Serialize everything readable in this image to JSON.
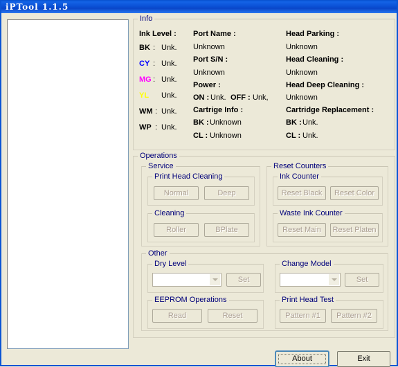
{
  "window": {
    "title": "iPTool 1.1.5"
  },
  "info": {
    "caption": "Info",
    "ink_level_label": "Ink Level :",
    "inks": [
      {
        "name": "BK",
        "sep": ":",
        "value": "Unk.",
        "color": "#000000"
      },
      {
        "name": "CY",
        "sep": ":",
        "value": "Unk.",
        "color": "#0000ff"
      },
      {
        "name": "MG",
        "sep": ":",
        "value": "Unk.",
        "color": "#ff00ff"
      },
      {
        "name": "YL",
        "sep": "",
        "value": "Unk.",
        "color": "#ffff00"
      },
      {
        "name": "WM",
        "sep": ":",
        "value": "Unk.",
        "color": "#000000"
      },
      {
        "name": "WP",
        "sep": ":",
        "value": "Unk.",
        "color": "#000000"
      }
    ],
    "port_name_label": "Port Name :",
    "port_name_value": "Unknown",
    "port_sn_label": "Port S/N :",
    "port_sn_value": "Unknown",
    "power_label": "Power :",
    "power_on_label": "ON :",
    "power_on_value": "Unk.",
    "power_off_label": "OFF :",
    "power_off_value": "Unk,",
    "cartrige_info_label": "Cartrige Info :",
    "cartrige_bk_label": "BK :",
    "cartrige_bk_value": "Unknown",
    "cartrige_cl_label": "CL :",
    "cartrige_cl_value": "Unknown",
    "head_parking_label": "Head Parking :",
    "head_parking_value": "Unknown",
    "head_cleaning_label": "Head Cleaning :",
    "head_cleaning_value": "Unknown",
    "head_deep_cleaning_label": "Head Deep Cleaning :",
    "head_deep_cleaning_value": "Unknown",
    "cartridge_replacement_label": "Cartridge Replacement :",
    "replacement_bk_label": "BK :",
    "replacement_bk_value": "Unk.",
    "replacement_cl_label": "CL :",
    "replacement_cl_value": "Unk."
  },
  "operations": {
    "caption": "Operations",
    "service": {
      "caption": "Service",
      "print_head_cleaning": {
        "caption": "Print Head Cleaning",
        "normal_label": "Normal",
        "deep_label": "Deep"
      },
      "cleaning": {
        "caption": "Cleaning",
        "roller_label": "Roller",
        "bplate_label": "BPlate"
      }
    },
    "reset_counters": {
      "caption": "Reset Counters",
      "ink_counter": {
        "caption": "Ink Counter",
        "reset_black_label": "Reset Black",
        "reset_color_label": "Reset Color"
      },
      "waste_ink_counter": {
        "caption": "Waste Ink Counter",
        "reset_main_label": "Reset Main",
        "reset_platen_label": "Reset Platen"
      }
    },
    "other": {
      "caption": "Other",
      "dry_level": {
        "caption": "Dry Level",
        "value": "",
        "set_label": "Set"
      },
      "change_model": {
        "caption": "Change Model",
        "value": "",
        "set_label": "Set"
      },
      "eeprom": {
        "caption": "EEPROM Operations",
        "read_label": "Read",
        "reset_label": "Reset"
      },
      "print_head_test": {
        "caption": "Print Head Test",
        "pattern1_label": "Pattern #1",
        "pattern2_label": "Pattern #2"
      }
    }
  },
  "footer": {
    "about_label": "About",
    "exit_label": "Exit"
  },
  "colors": {
    "titlebar": "#0a4fd4",
    "face": "#ece9d8",
    "group_caption": "#00007a",
    "disabled_text": "#aca093"
  }
}
